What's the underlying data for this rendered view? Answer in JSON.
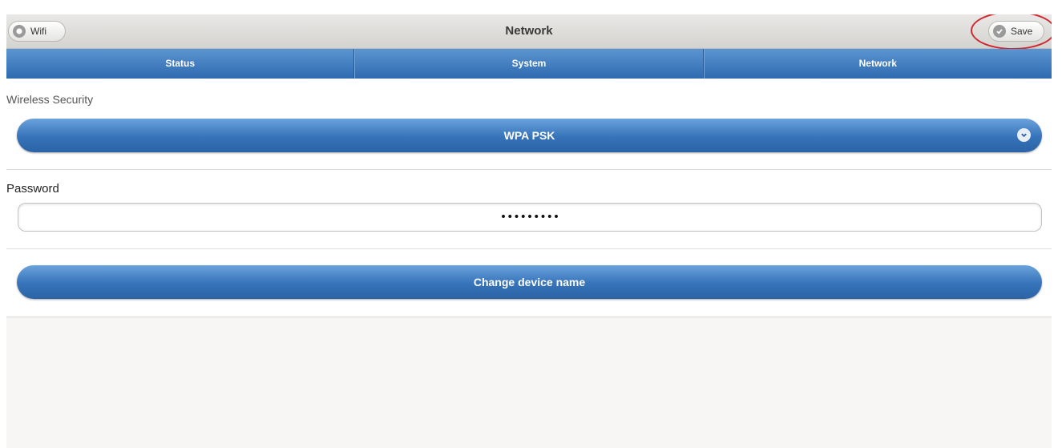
{
  "header": {
    "title": "Network",
    "back_label": "Wifi",
    "save_label": "Save"
  },
  "tabs": [
    {
      "label": "Status"
    },
    {
      "label": "System"
    },
    {
      "label": "Network"
    }
  ],
  "security": {
    "label": "Wireless Security",
    "selected": "WPA PSK"
  },
  "password": {
    "label": "Password",
    "value": "•••••••••"
  },
  "rename_button_label": "Change device name",
  "icons": {
    "back": "radio-circle-icon",
    "save": "check-circle-icon",
    "select": "chevron-down-circle-icon"
  },
  "colors": {
    "accent": "#3673b9",
    "highlight": "#d0282e"
  }
}
